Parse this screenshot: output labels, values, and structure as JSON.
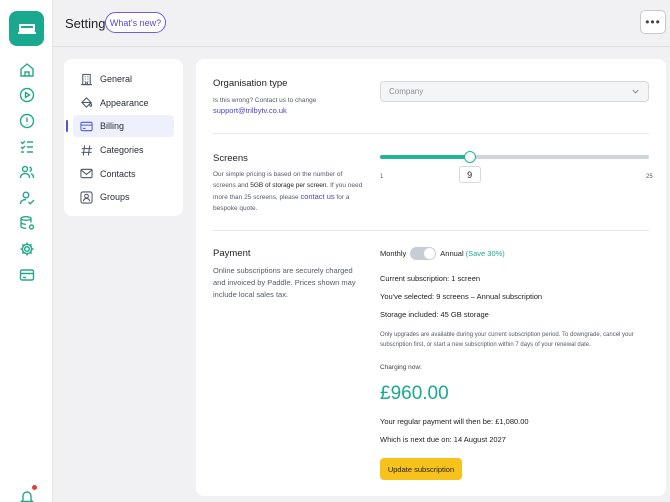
{
  "header": {
    "title": "Settings",
    "whats_new": "What's new?"
  },
  "nav": [
    {
      "label": "General",
      "icon": "building-icon"
    },
    {
      "label": "Appearance",
      "icon": "paint-bucket-icon"
    },
    {
      "label": "Billing",
      "icon": "credit-card-icon"
    },
    {
      "label": "Categories",
      "icon": "hash-icon"
    },
    {
      "label": "Contacts",
      "icon": "mail-icon"
    },
    {
      "label": "Groups",
      "icon": "user-group-icon"
    }
  ],
  "org": {
    "label": "Organisation type",
    "help": "Is this wrong? Contact us to change",
    "email": "support@trilbytv.co.uk",
    "value": "Company"
  },
  "screens": {
    "label": "Screens",
    "help_a": "Our simple pricing is based on the number of screens and ",
    "help_b": "5GB of storage per screen",
    "help_c": ". If you need more than 25 screens, please ",
    "help_link": "contact us",
    "help_d": " for a bespoke quote.",
    "min": "1",
    "max": "25",
    "value": 9,
    "value_label": "9"
  },
  "payment": {
    "label": "Payment",
    "help": "Online subscriptions are securely charged and invoiced by Paddle. Prices shown may include local sales tax.",
    "monthly": "Monthly",
    "annual": "Annual",
    "save": "(Save 30%)",
    "current_prefix": "Current subscription: ",
    "current": "1 screen",
    "selected_prefix": "You've selected: ",
    "selected": "9 screens – Annual subscription",
    "storage_prefix": "Storage included: ",
    "storage": "45 GB storage",
    "note": "Only upgrades are available during your current subscription period. To downgrade, cancel your subscription first, or start a new subscription within 7 days of your renewal date.",
    "charging": "Charging now:",
    "price": "£960.00",
    "regular_prefix": "Your regular payment will then be: ",
    "regular": "£1,080.00",
    "next_prefix": "Which is next due on: ",
    "next": "14 August 2027",
    "update": "Update subscription"
  },
  "colors": {
    "accent": "#1aa98e",
    "link": "#4b3fd1",
    "button": "#f7c21b"
  }
}
